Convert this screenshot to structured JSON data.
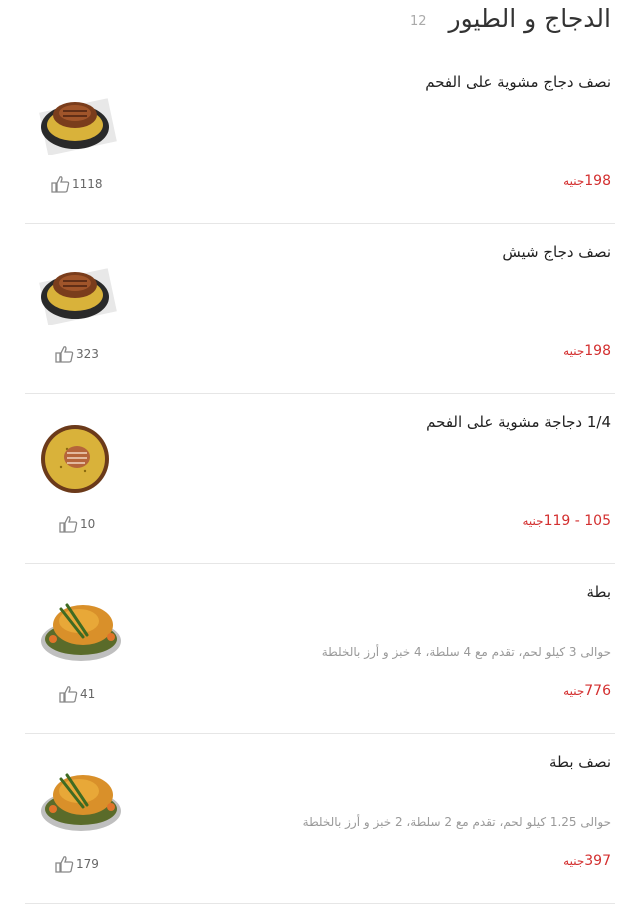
{
  "category": {
    "title": "الدجاج و الطيور",
    "count": "12"
  },
  "currency": "جنيه",
  "items": [
    {
      "name": "نصف دجاج مشوية على الفحم",
      "description": "",
      "price": "198",
      "likes": "1118",
      "image_icon": "grilled-chicken-plate-icon"
    },
    {
      "name": "نصف دجاج شيش",
      "description": "",
      "price": "198",
      "likes": "323",
      "image_icon": "grilled-chicken-plate-icon"
    },
    {
      "name": "1/4 دجاجة مشوية على الفحم",
      "description": "",
      "price": "105 - 119",
      "likes": "10",
      "image_icon": "chicken-rice-plate-icon"
    },
    {
      "name": "بطة",
      "description": "حوالى 3 كيلو لحم، تقدم مع 4 سلطة، 4 خبز و أرز بالخلطة",
      "price": "776",
      "likes": "41",
      "image_icon": "roasted-duck-icon"
    },
    {
      "name": "نصف بطة",
      "description": "حوالى 1.25 كيلو لحم، تقدم مع 2 سلطة، 2 خبز و أرز بالخلطة",
      "price": "397",
      "likes": "179",
      "image_icon": "roasted-duck-icon"
    }
  ],
  "colors": {
    "price": "#d32f2f",
    "title": "#333333",
    "muted": "#999999",
    "divider": "#e6e6e6"
  }
}
